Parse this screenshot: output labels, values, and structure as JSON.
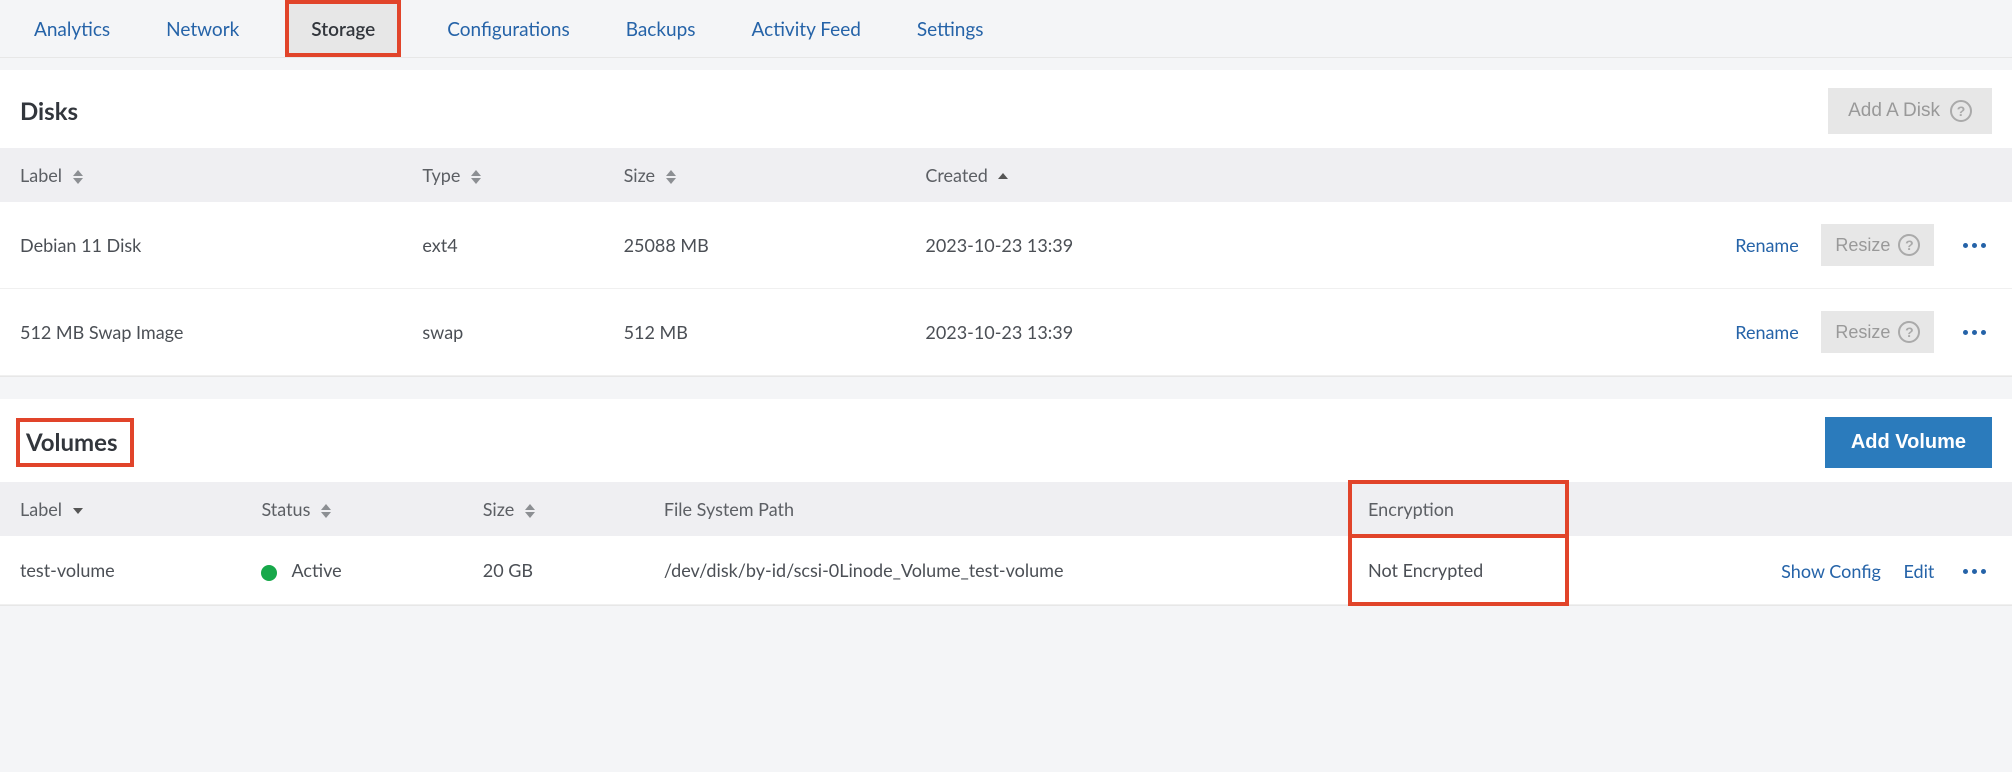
{
  "tabs": {
    "analytics": "Analytics",
    "network": "Network",
    "storage": "Storage",
    "configurations": "Configurations",
    "backups": "Backups",
    "activity_feed": "Activity Feed",
    "settings": "Settings"
  },
  "disks": {
    "title": "Disks",
    "add_button": "Add A Disk",
    "columns": {
      "label": "Label",
      "type": "Type",
      "size": "Size",
      "created": "Created"
    },
    "rows": [
      {
        "label": "Debian 11 Disk",
        "type": "ext4",
        "size": "25088 MB",
        "created": "2023-10-23 13:39"
      },
      {
        "label": "512 MB Swap Image",
        "type": "swap",
        "size": "512 MB",
        "created": "2023-10-23 13:39"
      }
    ],
    "row_actions": {
      "rename": "Rename",
      "resize": "Resize"
    }
  },
  "volumes": {
    "title": "Volumes",
    "add_button": "Add Volume",
    "columns": {
      "label": "Label",
      "status": "Status",
      "size": "Size",
      "fs_path": "File System Path",
      "encryption": "Encryption"
    },
    "rows": [
      {
        "label": "test-volume",
        "status": "Active",
        "size": "20 GB",
        "fs_path": "/dev/disk/by-id/scsi-0Linode_Volume_test-volume",
        "encryption": "Not Encrypted"
      }
    ],
    "row_actions": {
      "show_config": "Show Config",
      "edit": "Edit"
    }
  }
}
